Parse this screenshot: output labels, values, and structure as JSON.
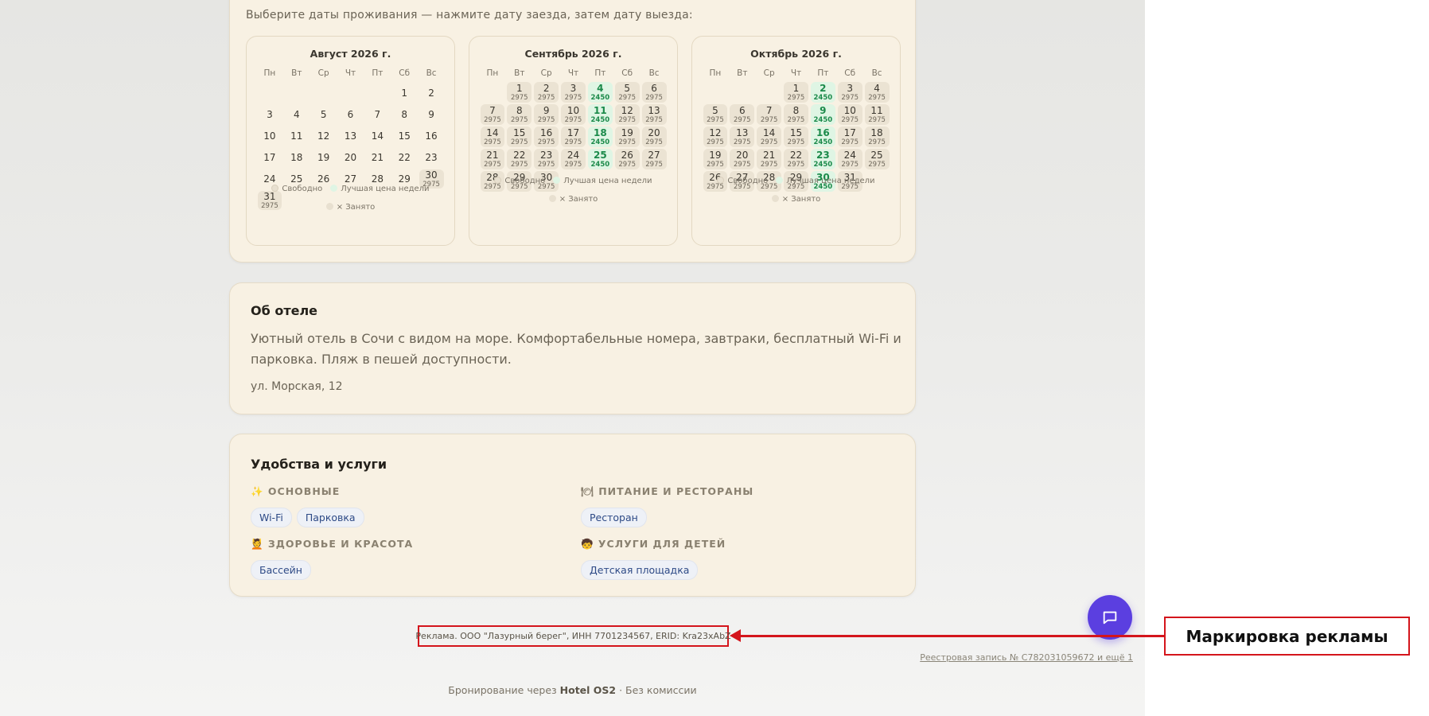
{
  "booking": {
    "hint": "Выберите даты проживания — нажмите дату заезда, затем дату выезда:",
    "weekdays": [
      "Пн",
      "Вт",
      "Ср",
      "Чт",
      "Пт",
      "Сб",
      "Вс"
    ],
    "legend": {
      "free": "Свободно",
      "best": "Лучшая цена недели",
      "busy": "× Занято"
    },
    "months": [
      {
        "title": "Август 2026 г.",
        "offset": 5,
        "days": [
          {
            "d": "1"
          },
          {
            "d": "2"
          },
          {
            "d": "3"
          },
          {
            "d": "4"
          },
          {
            "d": "5"
          },
          {
            "d": "6"
          },
          {
            "d": "7"
          },
          {
            "d": "8"
          },
          {
            "d": "9"
          },
          {
            "d": "10"
          },
          {
            "d": "11"
          },
          {
            "d": "12"
          },
          {
            "d": "13"
          },
          {
            "d": "14"
          },
          {
            "d": "15"
          },
          {
            "d": "16"
          },
          {
            "d": "17"
          },
          {
            "d": "18"
          },
          {
            "d": "19"
          },
          {
            "d": "20"
          },
          {
            "d": "21"
          },
          {
            "d": "22"
          },
          {
            "d": "23"
          },
          {
            "d": "24"
          },
          {
            "d": "25"
          },
          {
            "d": "26"
          },
          {
            "d": "27"
          },
          {
            "d": "28"
          },
          {
            "d": "29"
          },
          {
            "d": "30",
            "p": "2975"
          },
          {
            "d": "31",
            "p": "2975"
          }
        ]
      },
      {
        "title": "Сентябрь 2026 г.",
        "offset": 1,
        "days": [
          {
            "d": "1",
            "p": "2975"
          },
          {
            "d": "2",
            "p": "2975"
          },
          {
            "d": "3",
            "p": "2975"
          },
          {
            "d": "4",
            "p": "2450",
            "best": true
          },
          {
            "d": "5",
            "p": "2975"
          },
          {
            "d": "6",
            "p": "2975"
          },
          {
            "d": "7",
            "p": "2975"
          },
          {
            "d": "8",
            "p": "2975"
          },
          {
            "d": "9",
            "p": "2975"
          },
          {
            "d": "10",
            "p": "2975"
          },
          {
            "d": "11",
            "p": "2450",
            "best": true
          },
          {
            "d": "12",
            "p": "2975"
          },
          {
            "d": "13",
            "p": "2975"
          },
          {
            "d": "14",
            "p": "2975"
          },
          {
            "d": "15",
            "p": "2975"
          },
          {
            "d": "16",
            "p": "2975"
          },
          {
            "d": "17",
            "p": "2975"
          },
          {
            "d": "18",
            "p": "2450",
            "best": true
          },
          {
            "d": "19",
            "p": "2975"
          },
          {
            "d": "20",
            "p": "2975"
          },
          {
            "d": "21",
            "p": "2975"
          },
          {
            "d": "22",
            "p": "2975"
          },
          {
            "d": "23",
            "p": "2975"
          },
          {
            "d": "24",
            "p": "2975"
          },
          {
            "d": "25",
            "p": "2450",
            "best": true
          },
          {
            "d": "26",
            "p": "2975"
          },
          {
            "d": "27",
            "p": "2975"
          },
          {
            "d": "28",
            "p": "2975"
          },
          {
            "d": "29",
            "p": "2975"
          },
          {
            "d": "30",
            "p": "2975"
          }
        ]
      },
      {
        "title": "Октябрь 2026 г.",
        "offset": 3,
        "days": [
          {
            "d": "1",
            "p": "2975"
          },
          {
            "d": "2",
            "p": "2450",
            "best": true
          },
          {
            "d": "3",
            "p": "2975"
          },
          {
            "d": "4",
            "p": "2975"
          },
          {
            "d": "5",
            "p": "2975"
          },
          {
            "d": "6",
            "p": "2975"
          },
          {
            "d": "7",
            "p": "2975"
          },
          {
            "d": "8",
            "p": "2975"
          },
          {
            "d": "9",
            "p": "2450",
            "best": true
          },
          {
            "d": "10",
            "p": "2975"
          },
          {
            "d": "11",
            "p": "2975"
          },
          {
            "d": "12",
            "p": "2975"
          },
          {
            "d": "13",
            "p": "2975"
          },
          {
            "d": "14",
            "p": "2975"
          },
          {
            "d": "15",
            "p": "2975"
          },
          {
            "d": "16",
            "p": "2450",
            "best": true
          },
          {
            "d": "17",
            "p": "2975"
          },
          {
            "d": "18",
            "p": "2975"
          },
          {
            "d": "19",
            "p": "2975"
          },
          {
            "d": "20",
            "p": "2975"
          },
          {
            "d": "21",
            "p": "2975"
          },
          {
            "d": "22",
            "p": "2975"
          },
          {
            "d": "23",
            "p": "2450",
            "best": true
          },
          {
            "d": "24",
            "p": "2975"
          },
          {
            "d": "25",
            "p": "2975"
          },
          {
            "d": "26",
            "p": "2975"
          },
          {
            "d": "27",
            "p": "2975"
          },
          {
            "d": "28",
            "p": "2975"
          },
          {
            "d": "29",
            "p": "2975"
          },
          {
            "d": "30",
            "p": "2450",
            "best": true
          },
          {
            "d": "31",
            "p": "2975"
          }
        ]
      }
    ]
  },
  "about": {
    "title": "Об отеле",
    "text": "Уютный отель в Сочи с видом на море. Комфортабельные номера, завтраки, бесплатный Wi-Fi и парковка. Пляж в пешей доступности.",
    "address": "ул. Морская, 12"
  },
  "amenities": {
    "title": "Удобства и услуги",
    "categories": [
      {
        "label": "✨ ОСНОВНЫЕ",
        "items": [
          "Wi-Fi",
          "Парковка"
        ]
      },
      {
        "label": "🍽 ПИТАНИЕ И РЕСТОРАНЫ",
        "items": [
          "Ресторан"
        ]
      },
      {
        "label": "💆 ЗДОРОВЬЕ И КРАСОТА",
        "items": [
          "Бассейн"
        ]
      },
      {
        "label": "🧒 УСЛУГИ ДЛЯ ДЕТЕЙ",
        "items": [
          "Детская площадка"
        ]
      }
    ]
  },
  "ad": {
    "text": "Реклама. ООО \"Лазурный берег\", ИНН 7701234567, ERID: Kra23xAbZ",
    "callout": "Маркировка рекламы"
  },
  "registry": "Реестровая запись № С782031059672 и ещё 1",
  "footer": {
    "prefix": "Бронирование через ",
    "brand": "Hotel OS2",
    "suffix": " · Без комиссии"
  },
  "colors": {
    "accent": "#5b3fe0",
    "annotation": "#d4151c",
    "best_price": "#1b8a4a",
    "card_bg": "#f8f1e3"
  },
  "icons": {
    "chat": "chat-bubble-icon"
  }
}
